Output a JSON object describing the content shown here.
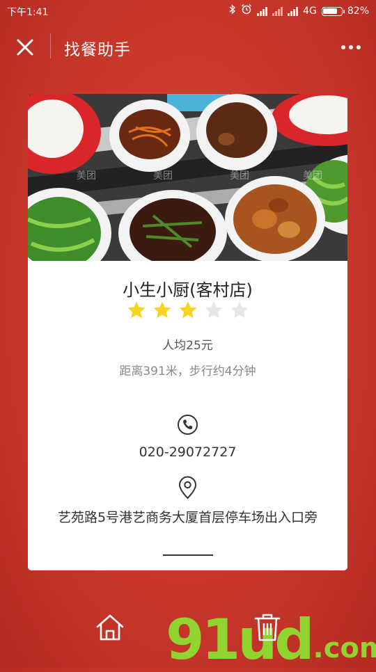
{
  "status_bar": {
    "time": "下午1:41",
    "network": "4G",
    "battery_percent": "82%",
    "battery_level": 0.82,
    "icons": [
      "bluetooth-icon",
      "alarm-icon",
      "signal-icon",
      "signal-icon",
      "battery-icon"
    ]
  },
  "nav": {
    "title": "找餐助手",
    "close_icon": "close-icon",
    "more_icon": "more-icon"
  },
  "restaurant": {
    "name": "小生小厨(客村店)",
    "rating": 3,
    "rating_max": 5,
    "price": "人均25元",
    "distance": "距离391米，步行约4分钟",
    "phone": "020-29072727",
    "address": "艺苑路5号港艺商务大厦首层停车场出入口旁"
  },
  "bottom_bar": {
    "home_icon": "home-icon",
    "trash_icon": "trash-icon"
  },
  "watermark": {
    "text": "91ud",
    "suffix": ".com"
  },
  "colors": {
    "background": "#c9372a",
    "star_on": "#f7d51d",
    "star_off": "#e6e6e6",
    "watermark": "#8fd431"
  }
}
